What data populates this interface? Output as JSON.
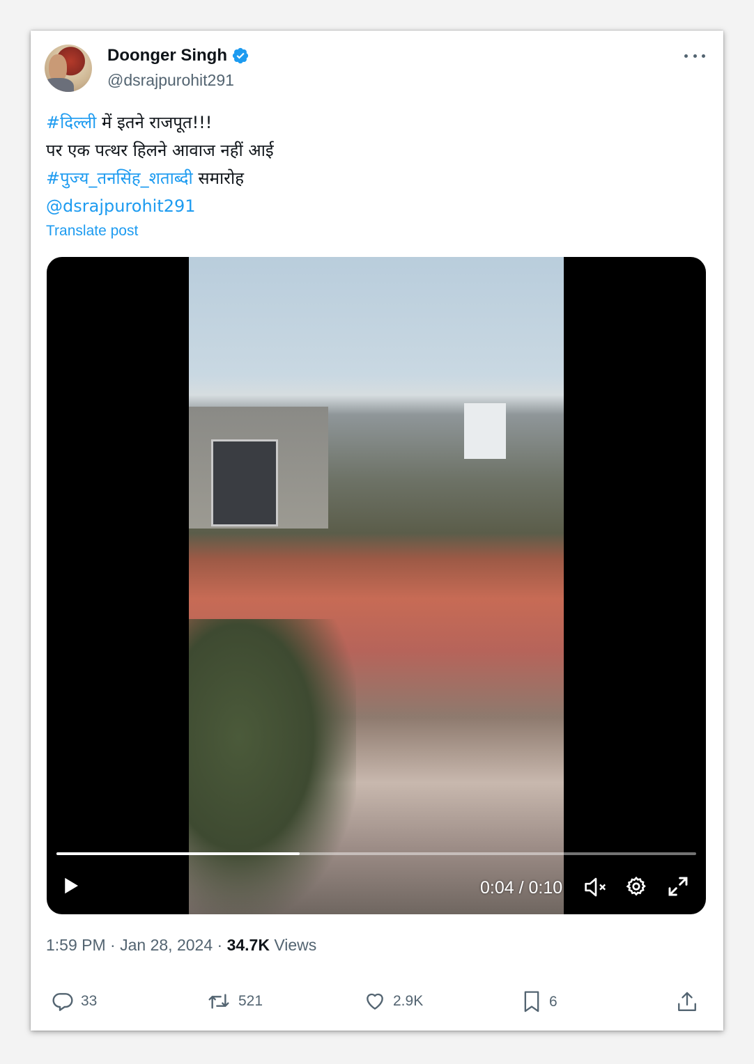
{
  "author": {
    "display_name": "Doonger Singh",
    "handle": "@dsrajpurohit291",
    "verified": true
  },
  "post": {
    "line1_tag": "#दिल्ली",
    "line1_text": " में इतने राजपूत!!!",
    "line2": "पर एक पत्थर हिलने आवाज नहीं आई",
    "line3_tag": "#पुज्य_तनसिंह_शताब्दी",
    "line3_text": " समारोह",
    "line4_mention": "@dsrajpurohit291",
    "translate_label": "Translate post"
  },
  "video": {
    "time_display": "0:04 / 0:10",
    "progress_fraction": 0.38
  },
  "meta": {
    "time": "1:59 PM",
    "sep1": " · ",
    "date": "Jan 28, 2024",
    "sep2": " · ",
    "views_count": "34.7K",
    "views_label": " Views"
  },
  "actions": {
    "replies": "33",
    "reposts": "521",
    "likes": "2.9K",
    "bookmarks": "6"
  },
  "icons": [
    "verified-icon",
    "more-icon",
    "play-icon",
    "mute-icon",
    "settings-icon",
    "fullscreen-icon",
    "reply-icon",
    "repost-icon",
    "like-icon",
    "bookmark-icon",
    "share-icon"
  ],
  "colors": {
    "link": "#1d9bf0",
    "secondary_text": "#536471",
    "primary_text": "#0f1419"
  }
}
